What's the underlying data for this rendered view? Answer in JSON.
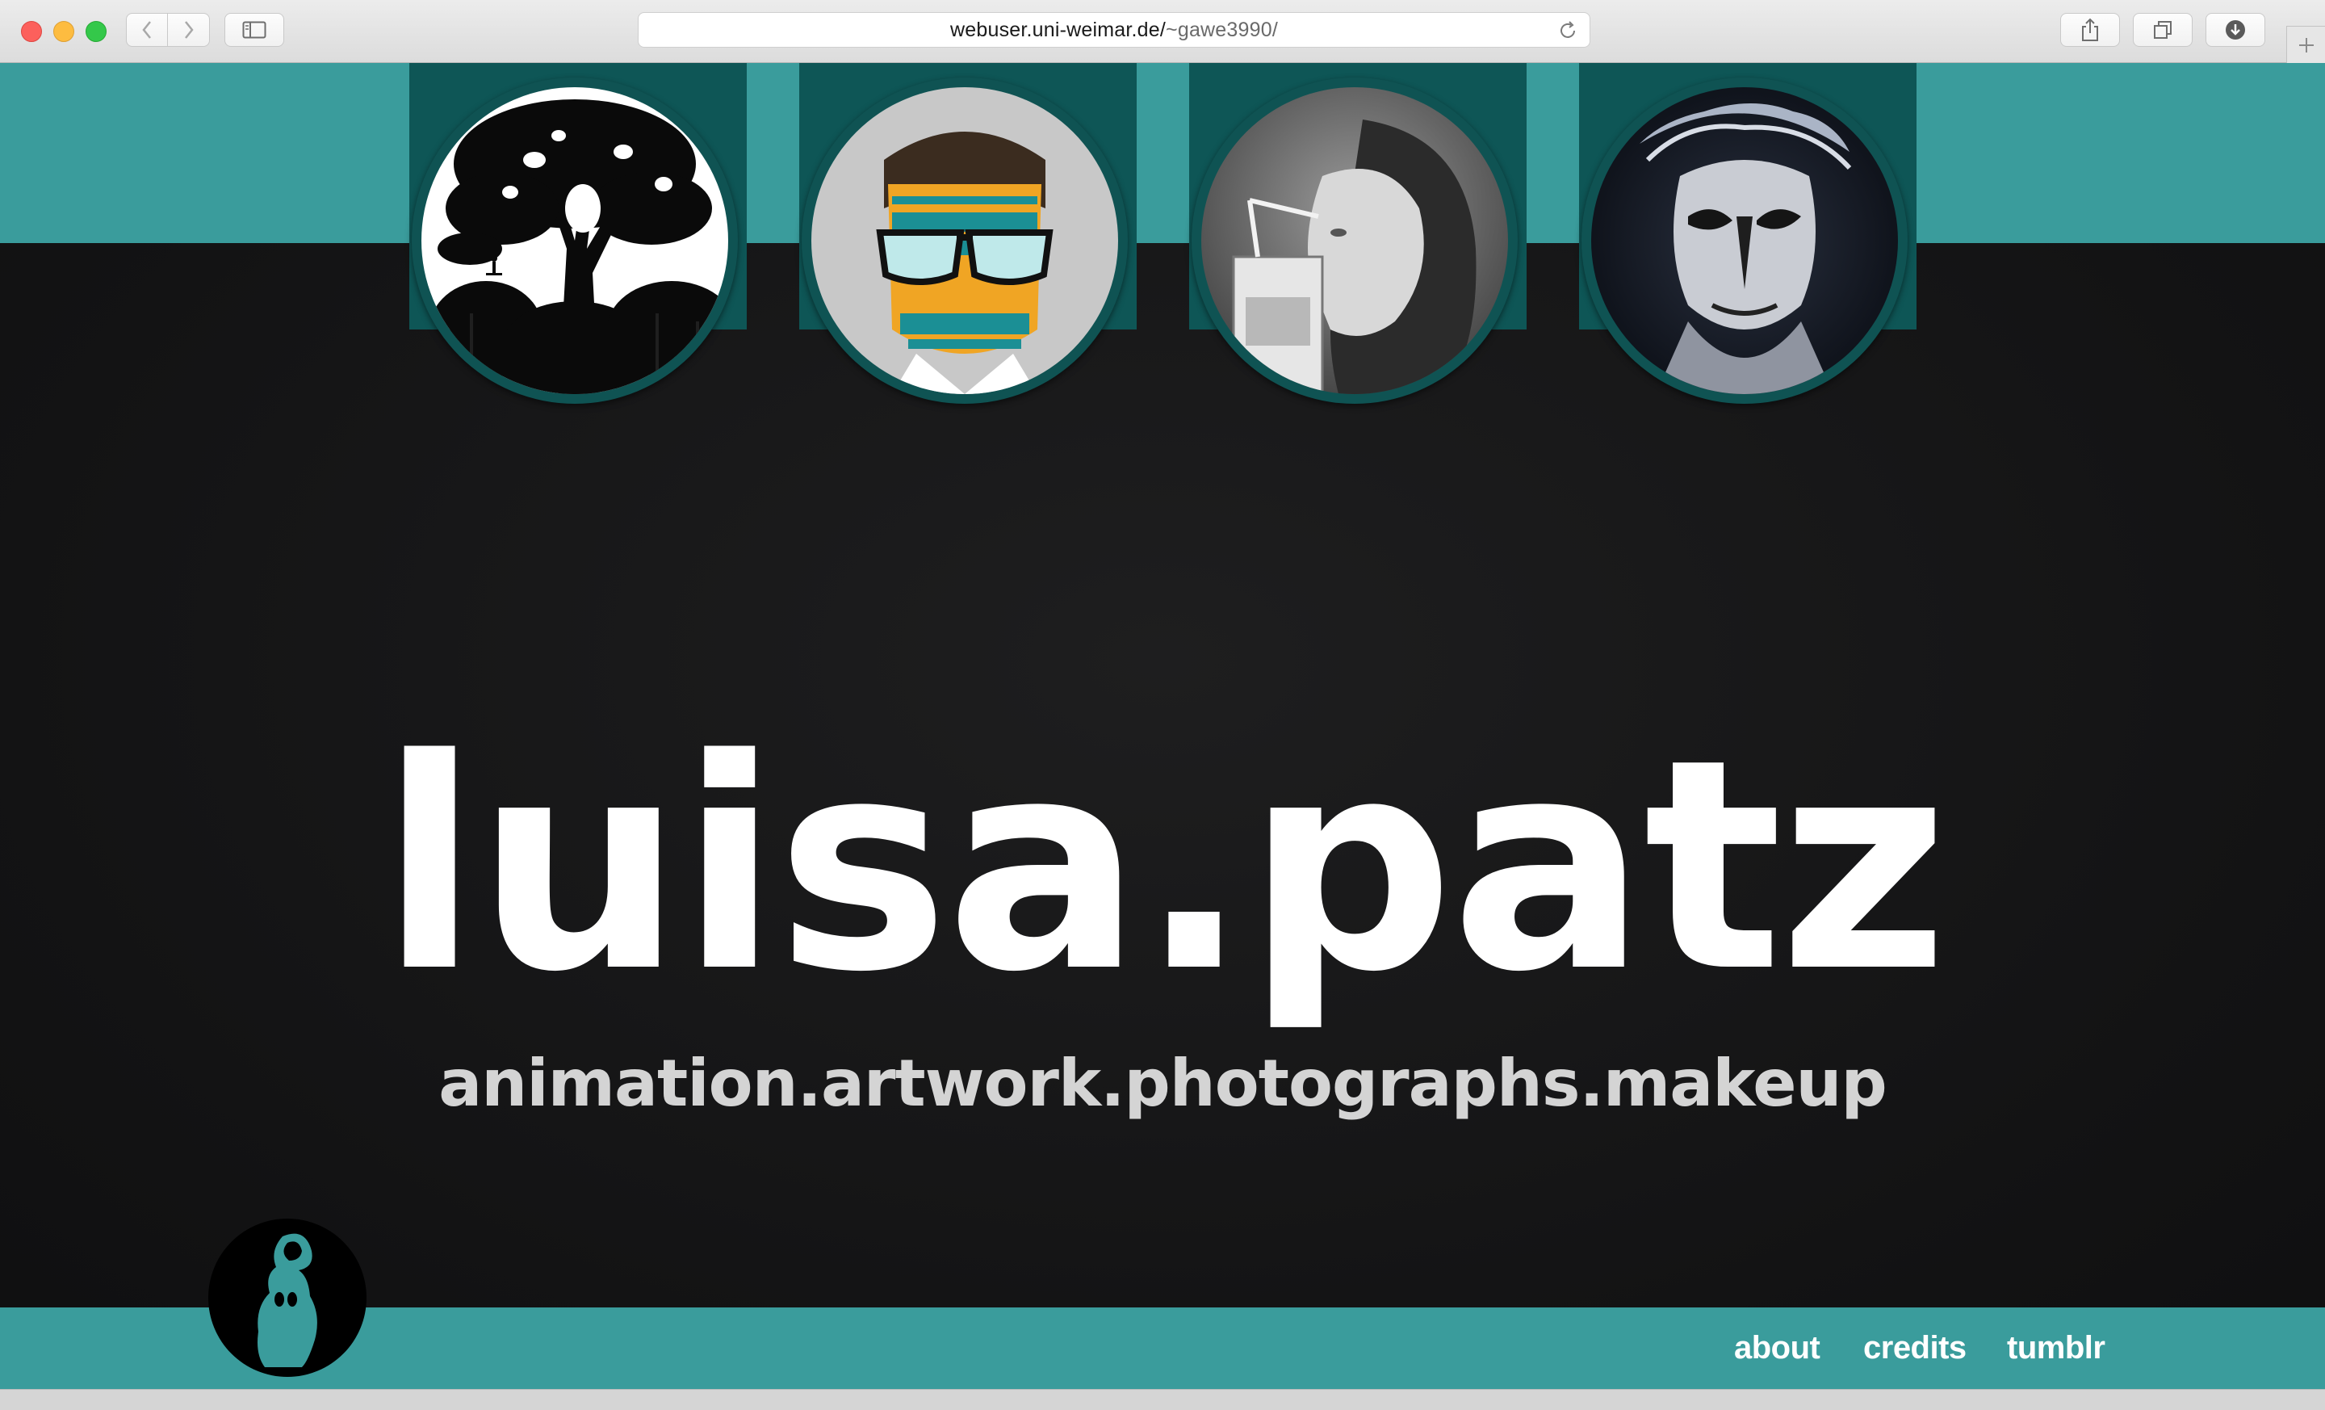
{
  "browser": {
    "url_host": "webuser.uni-weimar.de/",
    "url_path": "~gawe3990/",
    "icons": [
      "chevron-left-icon",
      "chevron-right-icon",
      "sidebar-icon",
      "reload-icon",
      "share-icon",
      "tabs-icon",
      "download-icon",
      "plus-icon"
    ]
  },
  "gallery": [
    {
      "name": "tree-silhouette-thumbnail"
    },
    {
      "name": "glasses-poster-thumbnail"
    },
    {
      "name": "girl-straw-photo-thumbnail"
    },
    {
      "name": "face-makeup-photo-thumbnail"
    }
  ],
  "hero": {
    "title": "luisa.patz",
    "subtitle": "animation.artwork.photographs.makeup"
  },
  "nav": {
    "about": "about",
    "credits": "credits",
    "tumblr": "tumblr"
  },
  "colors": {
    "teal": "#3a9c9c",
    "dark_teal": "#0e5656",
    "background": "#151516"
  }
}
